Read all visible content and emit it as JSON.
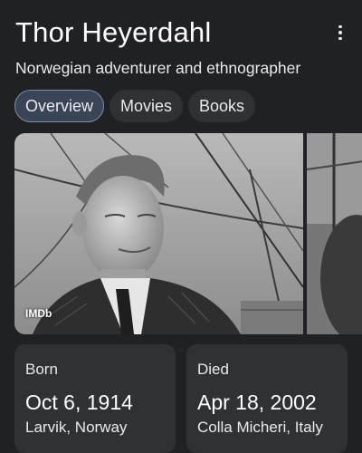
{
  "header": {
    "title": "Thor Heyerdahl",
    "subtitle": "Norwegian adventurer and ethnographer",
    "more_icon": "more-vert-icon"
  },
  "tabs": [
    {
      "label": "Overview",
      "active": true
    },
    {
      "label": "Movies",
      "active": false
    },
    {
      "label": "Books",
      "active": false
    }
  ],
  "photos": {
    "source_badge": "IMDb"
  },
  "facts": {
    "born": {
      "label": "Born",
      "date": "Oct 6, 1914",
      "place": "Larvik, Norway"
    },
    "died": {
      "label": "Died",
      "date": "Apr 18, 2002",
      "place": "Colla Micheri, Italy"
    }
  },
  "colors": {
    "background": "#202124",
    "chip": "#303134",
    "chip_active": "#394457",
    "card": "#303134"
  }
}
